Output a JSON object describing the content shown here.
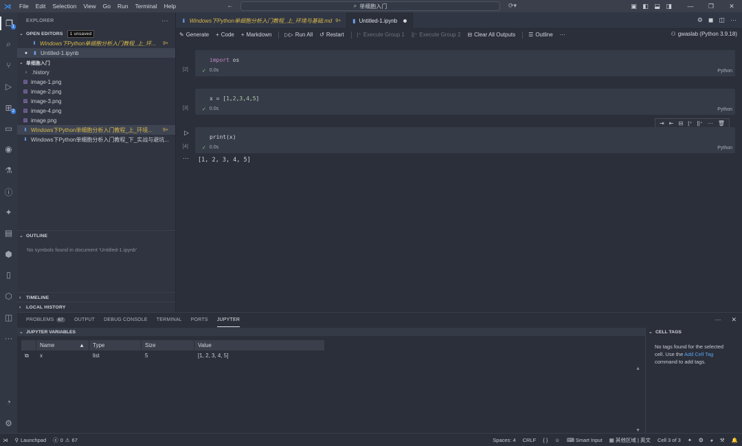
{
  "titlebar": {
    "menu": [
      "File",
      "Edit",
      "Selection",
      "View",
      "Go",
      "Run",
      "Terminal",
      "Help"
    ],
    "search_text": "单细胞入门"
  },
  "sidebar": {
    "explorer_title": "EXPLORER",
    "open_editors": {
      "title": "OPEN EDITORS",
      "badge": "1 unsaved",
      "items": [
        {
          "label": "Windows下Python单细胞分析入门教程_上_环...",
          "badge": "9+"
        },
        {
          "label": "Untitled-1.ipynb"
        }
      ]
    },
    "folder": {
      "title": "单细胞入门",
      "items": [
        {
          "label": ".history"
        },
        {
          "label": "image-1.png"
        },
        {
          "label": "image-2.png"
        },
        {
          "label": "image-3.png"
        },
        {
          "label": "image-4.png"
        },
        {
          "label": "image.png"
        },
        {
          "label": "Windows下Python单细胞分析入门教程_上_环境...",
          "badge": "9+"
        },
        {
          "label": "Windows下Python单细胞分析入门教程_下_实战与避坑..."
        }
      ]
    },
    "outline": {
      "title": "OUTLINE",
      "message": "No symbols found in document 'Untitled-1.ipynb'"
    },
    "timeline_title": "TIMELINE",
    "local_history_title": "LOCAL HISTORY"
  },
  "tabs": [
    {
      "label": "Windows下Python单细胞分析入门教程_上_环境与基础.md",
      "badge": "9+"
    },
    {
      "label": "Untitled-1.ipynb"
    }
  ],
  "toolbar": {
    "generate": "Generate",
    "code": "Code",
    "markdown": "Markdown",
    "run_all": "Run All",
    "restart": "Restart",
    "execute_group1": "Execute Group 1",
    "execute_group2": "Execute Group 2",
    "clear_outputs": "Clear All Outputs",
    "outline": "Outline",
    "kernel": "gwaslab (Python 3.9.18)"
  },
  "cells": [
    {
      "count": "[2]",
      "time": "0.0s",
      "lang": "Python"
    },
    {
      "count": "[3]",
      "time": "0.0s",
      "lang": "Python"
    },
    {
      "count": "[4]",
      "time": "0.0s",
      "lang": "Python"
    }
  ],
  "code": {
    "c1_kw": "import",
    "c1_rest": " os",
    "c2_prefix": "x = [",
    "c2_nums": [
      "1",
      "2",
      "3",
      "4",
      "5"
    ],
    "c2_suffix": "]",
    "c3": "print(x)"
  },
  "output": "[1, 2, 3, 4, 5]",
  "panel": {
    "tabs": {
      "problems": "PROBLEMS",
      "problems_count": "67",
      "output": "OUTPUT",
      "debug": "DEBUG CONSOLE",
      "terminal": "TERMINAL",
      "ports": "PORTS",
      "jupyter": "JUPYTER"
    },
    "variables_title": "JUPYTER VARIABLES",
    "columns": {
      "name": "Name",
      "type": "Type",
      "size": "Size",
      "value": "Value"
    },
    "rows": [
      {
        "name": "x",
        "type": "list",
        "size": "5",
        "value": "[1, 2, 3, 4, 5]"
      }
    ],
    "cell_tags_title": "CELL TAGS",
    "cell_tags_msg1": "No tags found for the selected cell. Use the ",
    "cell_tags_link": "Add Cell Tag",
    "cell_tags_msg2": " command to add tags."
  },
  "statusbar": {
    "launchpad": "Launchpad",
    "errors": "0",
    "warnings": "67",
    "spaces": "Spaces: 4",
    "eol": "CRLF",
    "braces": "{ }",
    "smart_input": "Smart Input",
    "region": "其他区域 | 英文",
    "cell_pos": "Cell 3 of 3"
  }
}
